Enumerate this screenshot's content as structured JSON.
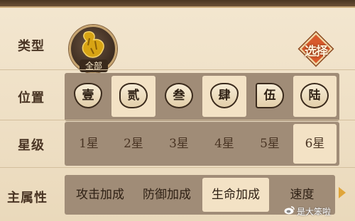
{
  "filters": {
    "type": {
      "label": "类型",
      "option_label": "全部",
      "select_button": "选择"
    },
    "position": {
      "label": "位置",
      "options": [
        "壹",
        "贰",
        "叁",
        "肆",
        "伍",
        "陆"
      ],
      "selected": [
        "贰",
        "肆",
        "陆"
      ]
    },
    "star": {
      "label": "星级",
      "options": [
        "1星",
        "2星",
        "3星",
        "4星",
        "5星",
        "6星"
      ],
      "selected": "6星"
    },
    "main_attr": {
      "label": "主属性",
      "options": [
        "攻击加成",
        "防御加成",
        "生命加成",
        "速度"
      ],
      "selected": "生命加成"
    }
  },
  "watermark": "是大笨啦",
  "colors": {
    "panel": "#f0e2c8",
    "track": "#a08c77",
    "selected_cell": "#f3e2c5",
    "accent": "#d85a2c",
    "text": "#4a3524"
  }
}
